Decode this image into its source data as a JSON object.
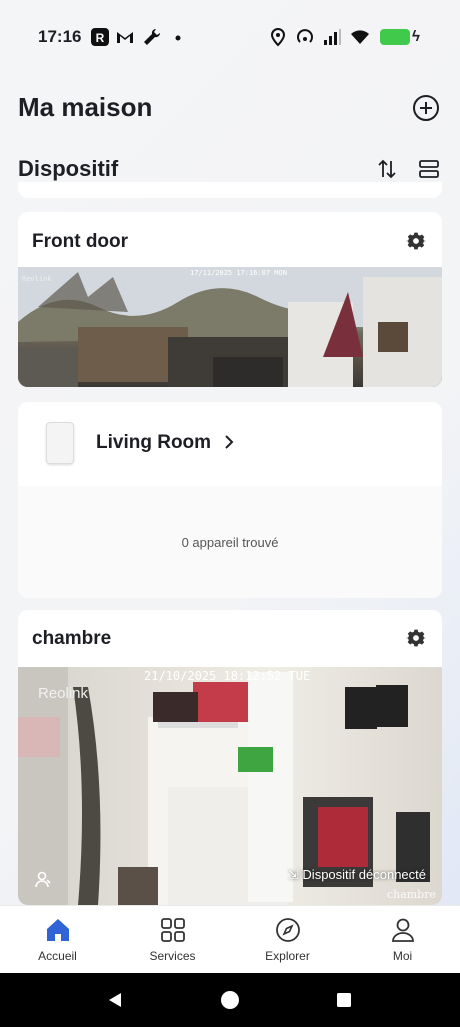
{
  "status_bar": {
    "time": "17:16",
    "icons": [
      "reolink-app-icon",
      "gmail-icon",
      "wrench-icon",
      "dot-icon",
      "location-icon",
      "hotspot-icon",
      "signal-icon",
      "wifi-icon",
      "battery-charging-icon"
    ],
    "battery_color": "#40c94a"
  },
  "header": {
    "title": "Ma maison",
    "add_icon": "plus-circle-icon"
  },
  "section": {
    "title": "Dispositif",
    "sort_icon": "sort-arrows-icon",
    "layout_icon": "list-layout-icon"
  },
  "cards": {
    "front_door": {
      "name": "Front door",
      "settings_icon": "gear-icon",
      "feed_timestamp": "17/11/2025 17:16:07 MON",
      "feed_brand": "Reolink"
    },
    "living_room": {
      "name": "Living Room",
      "device_icon": "home-hub-icon",
      "empty_message": "0 appareil trouvé"
    },
    "chambre": {
      "name": "chambre",
      "settings_icon": "gear-icon",
      "feed_timestamp": "21/10/2025 18:12:52 TUE",
      "feed_brand": "Reolink",
      "status": "Dispositif déconnecté",
      "camera_label": "chambre"
    }
  },
  "tabbar": {
    "active_color": "#2f63d6",
    "tabs": [
      {
        "label": "Accueil",
        "icon": "home-icon",
        "active": true
      },
      {
        "label": "Services",
        "icon": "grid-icon",
        "active": false
      },
      {
        "label": "Explorer",
        "icon": "compass-icon",
        "active": false
      },
      {
        "label": "Moi",
        "icon": "person-icon",
        "active": false
      }
    ]
  },
  "nav_bar": {
    "buttons": [
      "back-icon",
      "home-circle-icon",
      "recents-icon"
    ]
  }
}
